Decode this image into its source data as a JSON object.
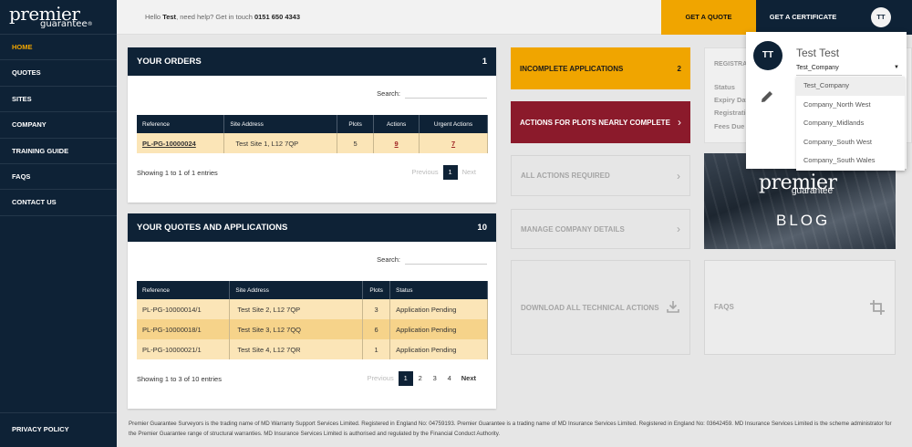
{
  "brand": {
    "line1": "premier",
    "line2": "guarantee",
    "reg_mark": "®"
  },
  "sidebar": {
    "items": [
      {
        "label": "HOME",
        "active": true
      },
      {
        "label": "QUOTES"
      },
      {
        "label": "SITES"
      },
      {
        "label": "COMPANY"
      },
      {
        "label": "TRAINING GUIDE"
      },
      {
        "label": "FAQS"
      },
      {
        "label": "CONTACT US"
      }
    ],
    "privacy": "PRIVACY POLICY"
  },
  "topbar": {
    "hello": "Hello",
    "user": "Test",
    "help": ", need help? Get in touch",
    "phone": "0151 650 4343",
    "get_quote": "GET A QUOTE",
    "get_certificate": "GET A CERTIFICATE",
    "avatar": "TT"
  },
  "orders": {
    "title": "YOUR ORDERS",
    "count": "1",
    "search_label": "Search:",
    "columns": [
      "Reference",
      "Site Address",
      "Plots",
      "Actions",
      "Urgent Actions"
    ],
    "rows": [
      {
        "ref": "PL-PG-10000024",
        "address": "Test Site 1, L12 7QP",
        "plots": "5",
        "actions": "9",
        "urgent": "7"
      }
    ],
    "entries": "Showing 1 to 1 of 1 entries",
    "pager": {
      "previous": "Previous",
      "pages": [
        "1"
      ],
      "next": "Next"
    }
  },
  "quotes": {
    "title": "YOUR QUOTES AND APPLICATIONS",
    "count": "10",
    "search_label": "Search:",
    "columns": [
      "Reference",
      "Site Address",
      "Plots",
      "Status"
    ],
    "rows": [
      {
        "ref": "PL-PG-10000014/1",
        "address": "Test Site 2, L12 7QP",
        "plots": "3",
        "status": "Application Pending"
      },
      {
        "ref": "PL-PG-10000018/1",
        "address": "Test Site 3, L12 7QQ",
        "plots": "6",
        "status": "Application Pending"
      },
      {
        "ref": "PL-PG-10000021/1",
        "address": "Test Site 4, L12 7QR",
        "plots": "1",
        "status": "Application Pending"
      }
    ],
    "entries": "Showing 1 to 3 of 10 entries",
    "pager": {
      "previous": "Previous",
      "pages": [
        "1",
        "2",
        "3",
        "4"
      ],
      "next": "Next"
    }
  },
  "tiles": {
    "incomplete": {
      "label": "INCOMPLETE APPLICATIONS",
      "count": "2"
    },
    "nearly_complete": {
      "label": "ACTIONS FOR PLOTS NEARLY COMPLETE",
      "chevron": "›"
    },
    "all_actions": {
      "label": "ALL ACTIONS REQUIRED",
      "chevron": "›"
    },
    "manage_company": {
      "label": "MANAGE COMPANY DETAILS",
      "chevron": "›"
    },
    "download_technical": {
      "label": "DOWNLOAD ALL TECHNICAL ACTIONS"
    },
    "faqs": {
      "label": "FAQS"
    }
  },
  "registration": {
    "title": "REGISTRATI",
    "status": "Status",
    "expiry": "Expiry Date",
    "registration": "Registratio",
    "fees_due": "Fees Due"
  },
  "blog": {
    "brand1": "premier",
    "brand2": "guarantee",
    "label": "BLOG"
  },
  "account_menu": {
    "avatar": "TT",
    "name": "Test Test",
    "selected_company": "Test_Company",
    "caret": "▼",
    "options": [
      "Test_Company",
      "Company_North West",
      "Company_Midlands",
      "Company_South West",
      "Company_South Wales"
    ]
  },
  "footer": {
    "text": "Premier Guarantee Surveyors is the trading name of MD Warranty Support Services Limited. Registered in England No: 04759193. Premier Guarantee is a trading name of MD Insurance Services Limited. Registered in England No: 03642459. MD Insurance Services Limited is the scheme administrator for the Premier Guarantee range of structural warranties. MD Insurance Services Limited is authorised and regulated by the Financial Conduct Authority."
  }
}
